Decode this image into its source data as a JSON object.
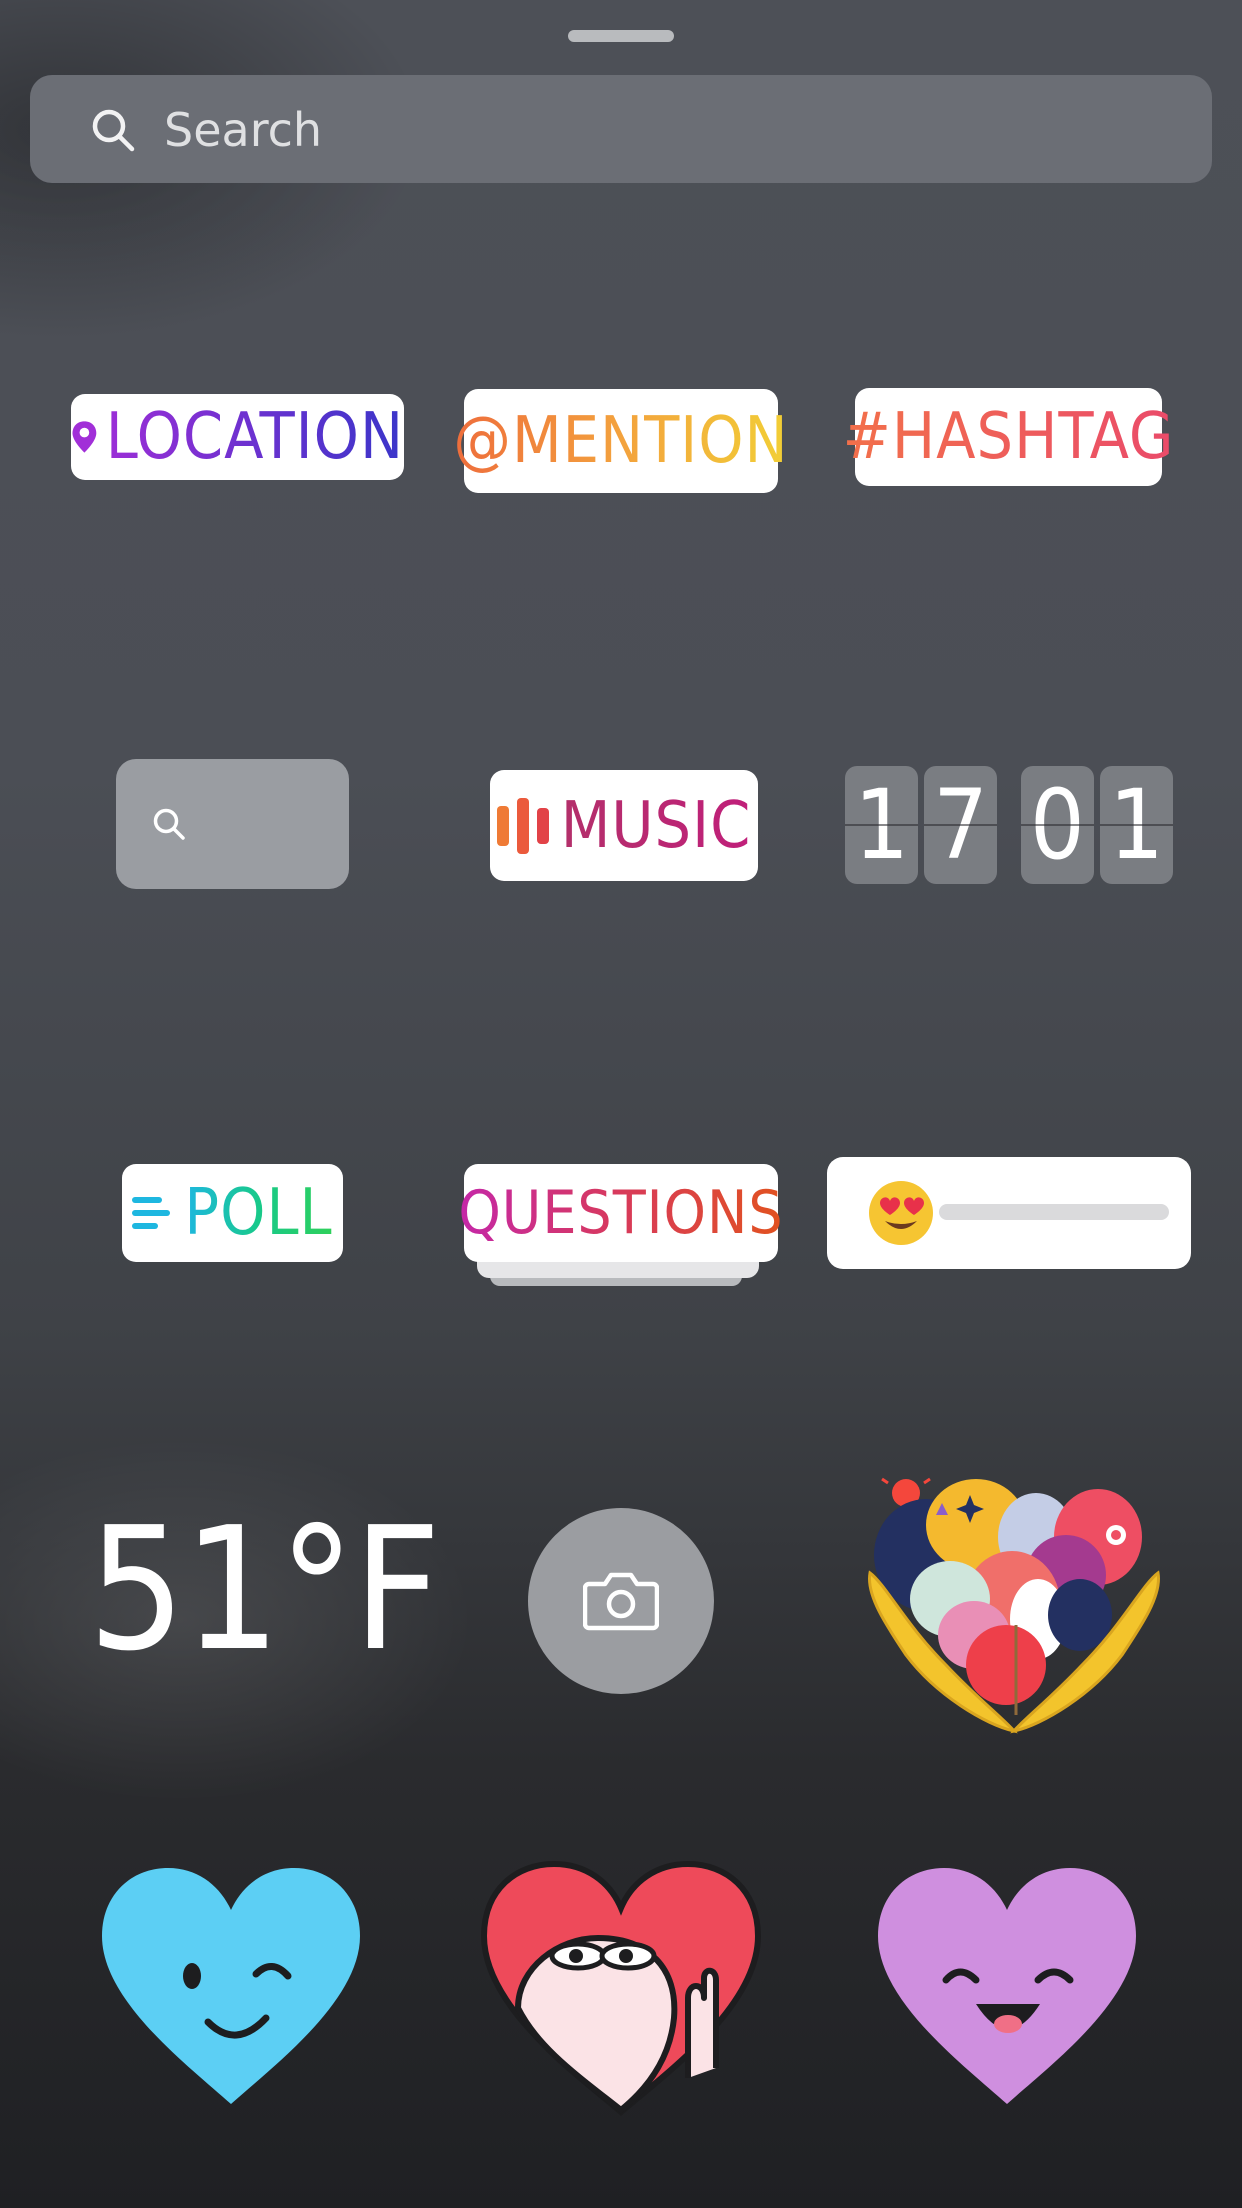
{
  "search": {
    "placeholder": "Search"
  },
  "stickers": {
    "location": "LOCATION",
    "mention": "@MENTION",
    "hashtag": "#HASHTAG",
    "music": "MUSIC",
    "countdown_digits": [
      "1",
      "7",
      "0",
      "1"
    ],
    "poll": "POLL",
    "questions": "QUESTIONS",
    "weather": "51°F",
    "slider_emoji": "heart-eyes-emoji"
  },
  "colors": {
    "location_gradient": [
      "#9b2ed6",
      "#3a35c9"
    ],
    "mention_gradient": [
      "#ee6d3c",
      "#f2cf36"
    ],
    "hashtag_gradient": [
      "#f2704a",
      "#ea4b6a"
    ],
    "music_accent": [
      "#ee6d3c",
      "#c01f7a"
    ],
    "poll_gradient": [
      "#1eb7e0",
      "#2fd05a"
    ],
    "questions_gradient": [
      "#c427a8",
      "#e1521f"
    ],
    "heart_blue": "#5ccff4",
    "heart_red": "#ee4a5a",
    "heart_purple": "#cf8fdf"
  },
  "icons": [
    "search-icon",
    "location-pin-icon",
    "music-bars-icon",
    "poll-lines-icon",
    "camera-icon"
  ]
}
